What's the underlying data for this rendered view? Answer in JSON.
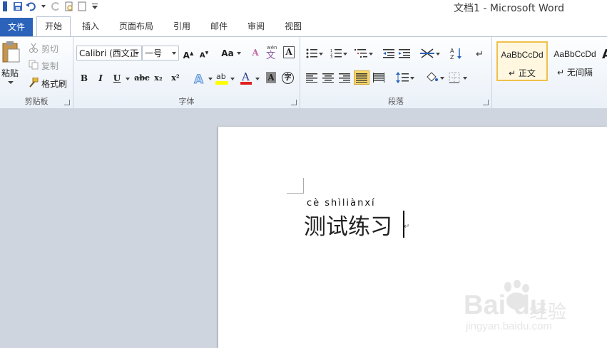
{
  "window": {
    "title": "文档1 - Microsoft Word"
  },
  "quick_access": [
    {
      "icon": "word-logo-icon"
    },
    {
      "icon": "save-icon"
    },
    {
      "icon": "undo-icon"
    },
    {
      "icon": "redo-icon"
    },
    {
      "icon": "print-preview-icon"
    },
    {
      "icon": "new-document-icon"
    },
    {
      "icon": "customize-qat-icon"
    }
  ],
  "tabs": [
    {
      "label": "文件",
      "kind": "file"
    },
    {
      "label": "开始",
      "active": true
    },
    {
      "label": "插入"
    },
    {
      "label": "页面布局"
    },
    {
      "label": "引用"
    },
    {
      "label": "邮件"
    },
    {
      "label": "审阅"
    },
    {
      "label": "视图"
    }
  ],
  "ribbon": {
    "clipboard": {
      "label": "剪贴板",
      "paste": "粘贴",
      "cut": "剪切",
      "copy": "复制",
      "format_painter": "格式刷"
    },
    "font": {
      "label": "字体",
      "font_name": "Calibri (西文正",
      "font_size": "一号",
      "buttons": {
        "grow": "A",
        "shrink": "A",
        "case": "Aa",
        "clear": "A",
        "bold": "B",
        "italic": "I",
        "underline": "U",
        "strike": "abc",
        "subscript": "x₂",
        "superscript": "x²",
        "highlight": "ab",
        "font_color": "A",
        "char_shading": "A",
        "enclose": "字",
        "phonetic": "wén",
        "phonetic_glyph": "文",
        "border": "A"
      }
    },
    "paragraph": {
      "label": "段落"
    },
    "styles": {
      "items": [
        {
          "sample": "AaBbCcDd",
          "name": "正文",
          "selected": true
        },
        {
          "sample": "AaBbCcDd",
          "name": "无间隔"
        }
      ]
    }
  },
  "document": {
    "pinyin": "cè shìliànxí",
    "text": "测试练习",
    "para_mark": "↵"
  },
  "watermark": {
    "logo": "Bai du",
    "cn": "经验",
    "url": "jingyan.baidu.com"
  },
  "colors": {
    "file_tab": "#2a63b9",
    "style_selected_border": "#f0c14a",
    "highlight": "#ffff00",
    "font_color": "#e02020"
  }
}
